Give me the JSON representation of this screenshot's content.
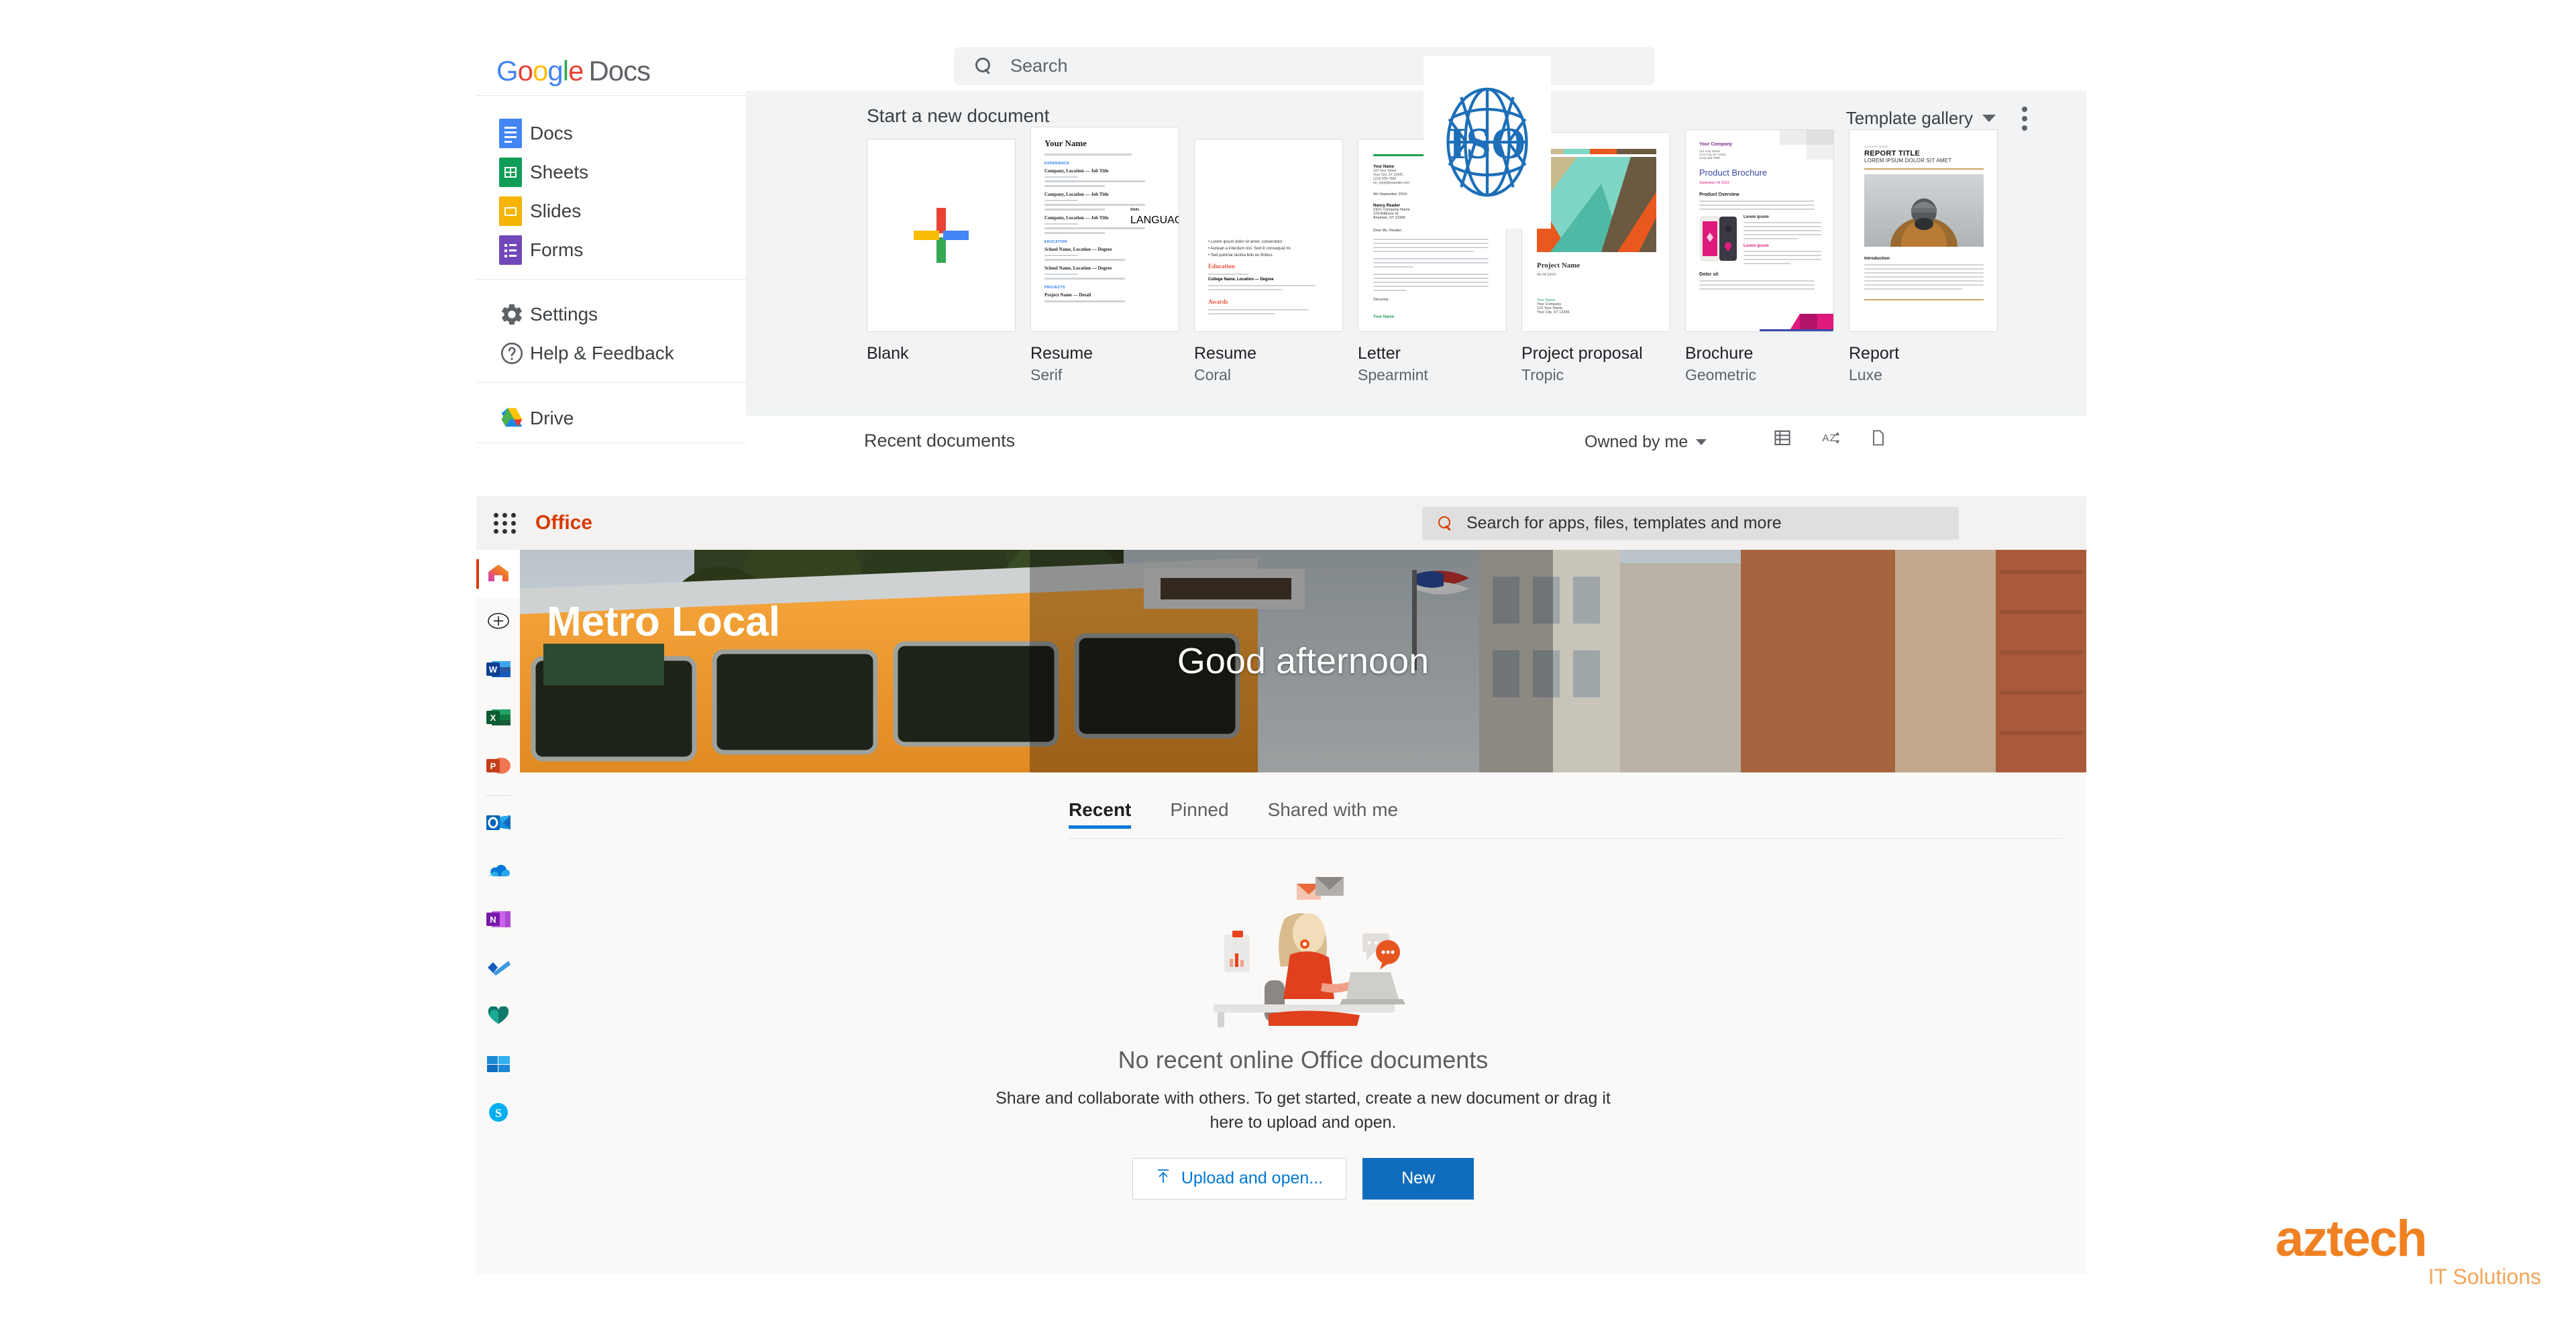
{
  "google_docs": {
    "logo": {
      "g1": "G",
      "o1": "o",
      "o2": "o",
      "g2": "g",
      "l": "l",
      "e": "e",
      "product": "Docs"
    },
    "search": {
      "placeholder": "Search",
      "value": ""
    },
    "sidebar_items": [
      {
        "label": "Docs",
        "icon": "google-docs-icon"
      },
      {
        "label": "Sheets",
        "icon": "google-sheets-icon"
      },
      {
        "label": "Slides",
        "icon": "google-slides-icon"
      },
      {
        "label": "Forms",
        "icon": "google-forms-icon"
      },
      {
        "label": "Settings",
        "icon": "gear-icon"
      },
      {
        "label": "Help & Feedback",
        "icon": "help-circle-icon"
      },
      {
        "label": "Drive",
        "icon": "google-drive-icon"
      }
    ],
    "gallery": {
      "heading": "Start a new document",
      "template_gallery_label": "Template gallery",
      "more_options": "more-options",
      "templates": [
        {
          "name": "Blank",
          "style": ""
        },
        {
          "name": "Resume",
          "style": "Serif"
        },
        {
          "name": "Resume",
          "style": "Coral"
        },
        {
          "name": "Letter",
          "style": "Spearmint"
        },
        {
          "name": "Project proposal",
          "style": "Tropic"
        },
        {
          "name": "Brochure",
          "style": "Geometric"
        },
        {
          "name": "Report",
          "style": "Luxe"
        }
      ]
    },
    "overlay": {
      "text": "ISO",
      "color": "#1d6fb8"
    },
    "recent": {
      "title": "Recent documents",
      "owner_filter": "Owned by me",
      "view_list": "list-view",
      "sort_az": "sort-az",
      "folder": "open-file-picker"
    },
    "thumbs": {
      "resume_serif": {
        "name": "Your Name",
        "sections": [
          "EXPERIENCE",
          "EDUCATION",
          "PROJECTS"
        ],
        "jobs": [
          "Company, Location — Job Title",
          "Company, Location — Job Title",
          "Company, Location — Job Title"
        ],
        "schools": [
          "School Name, Location — Degree",
          "School Name, Location — Degree"
        ],
        "project": "Project Name — Detail",
        "sidebar_sections": [
          "SKILLS",
          "LANGUAGES"
        ]
      },
      "resume_coral": {
        "sections": [
          "Education",
          "Awards"
        ]
      },
      "letter_spearmint": {
        "sender": "Your Name",
        "address": [
          "123 Your Street",
          "Your City, ST 12345",
          "(123) 456-7890",
          "no_reply@example.com"
        ],
        "date": "4th September 20XX",
        "recipient": [
          "Nancy Reader",
          "CEO, Company Name",
          "123 Address St",
          "Anytown, ST 12345"
        ],
        "salutation": "Dear Ms. Reader,",
        "closing": "Sincerely,",
        "signature": "Your Name",
        "accent": "#1e9e54"
      },
      "project_proposal": {
        "title": "Project Name",
        "date": "09.04.20XX",
        "contact": [
          "Your Name",
          "Your Company",
          "123 Your Street",
          "Your City, ST 12345"
        ],
        "accent": "#7fd6c4"
      },
      "brochure": {
        "company": "Your Company",
        "address": [
          "123 Your Street",
          "Your City, ST 12345",
          "(123) 456-7890"
        ],
        "title": "Product Brochure",
        "date": "September 04 20XX",
        "h_overview": "Product Overview",
        "h_lorem": "Lorem ipsum",
        "h_lorem2": "Lorem ipsum",
        "h_dolor": "Dolor sit",
        "accent": "#e0197d",
        "accent2": "#3b4ba8"
      },
      "report": {
        "course": "COURSE NAME",
        "title": "REPORT TITLE",
        "subtitle": "LOREM IPSUM DOLOR SIT AMET",
        "section": "Introduction",
        "accent": "#c8a465"
      }
    }
  },
  "office": {
    "waffle": "app-launcher",
    "brand": "Office",
    "search": {
      "placeholder": "Search for apps, files, templates and more",
      "value": ""
    },
    "rail": [
      {
        "name": "home",
        "icon": "office-home-icon",
        "selected": true
      },
      {
        "name": "create-new",
        "icon": "plus-circle-icon",
        "selected": false
      },
      {
        "name": "word",
        "icon": "word-icon",
        "selected": false
      },
      {
        "name": "excel",
        "icon": "excel-icon",
        "selected": false
      },
      {
        "name": "powerpoint",
        "icon": "powerpoint-icon",
        "selected": false
      },
      {
        "name": "outlook",
        "icon": "outlook-icon",
        "selected": false
      },
      {
        "name": "onedrive",
        "icon": "onedrive-icon",
        "selected": false
      },
      {
        "name": "onenote",
        "icon": "onenote-icon",
        "selected": false
      },
      {
        "name": "todo",
        "icon": "todo-icon",
        "selected": false
      },
      {
        "name": "family-safety",
        "icon": "family-safety-icon",
        "selected": false
      },
      {
        "name": "sharepoint",
        "icon": "sharepoint-icon",
        "selected": false
      },
      {
        "name": "skype",
        "icon": "skype-icon",
        "selected": false
      }
    ],
    "hero": {
      "greeting": "Good afternoon",
      "image_caption": "Metro Local"
    },
    "tabs": [
      {
        "label": "Recent",
        "active": true
      },
      {
        "label": "Pinned",
        "active": false
      },
      {
        "label": "Shared with me",
        "active": false
      }
    ],
    "empty_state": {
      "illustration": "person-at-laptop-illustration",
      "title": "No recent online Office documents",
      "description": "Share and collaborate with others. To get started, create a new document or drag it here to upload and open.",
      "upload_button": "Upload and open...",
      "new_button": "New"
    }
  },
  "watermark": {
    "brand": "aztech",
    "tagline": "IT Solutions",
    "color": "#F08122",
    "tagline_color": "#F2A65A"
  }
}
